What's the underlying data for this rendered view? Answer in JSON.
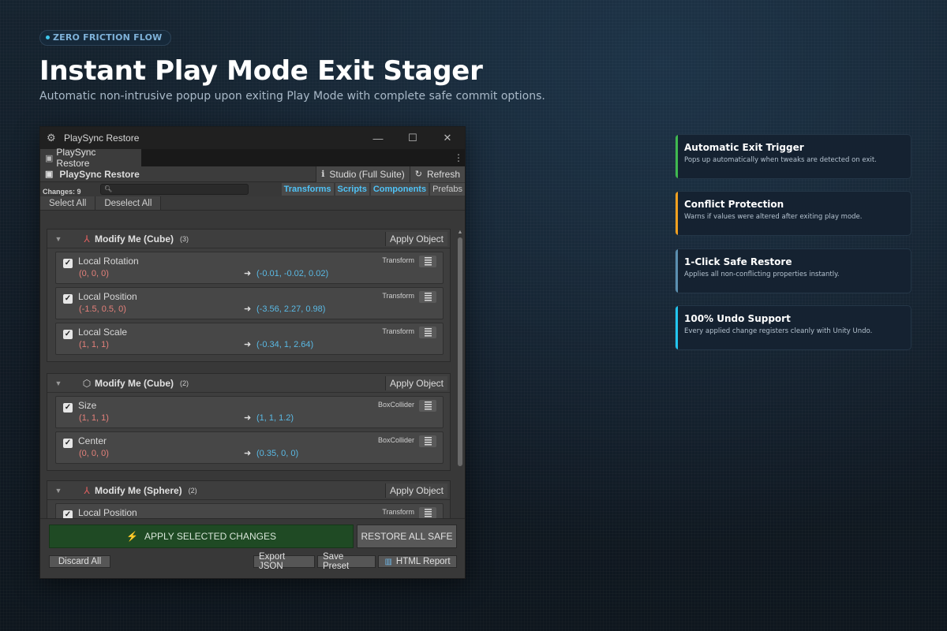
{
  "hero": {
    "badge": "ZERO FRICTION FLOW",
    "title": "Instant Play Mode Exit Stager",
    "subtitle": "Automatic non-intrusive popup upon exiting Play Mode with complete safe commit options."
  },
  "window": {
    "title": "PlaySync Restore",
    "tab_label": "PlaySync Restore",
    "toolbar": {
      "name": "PlaySync Restore",
      "edition": "Studio (Full Suite)",
      "refresh": "Refresh"
    },
    "changes_count": "Changes: 9",
    "search_placeholder": "",
    "filters": [
      "Transforms",
      "Scripts",
      "Components",
      "Prefabs"
    ],
    "select_all": "Select All",
    "deselect_all": "Deselect All",
    "apply_object_label": "Apply Object",
    "groups": [
      {
        "title": "Modify Me (Cube)",
        "count": "(3)",
        "icon": "transform-gizmo-icon",
        "props": [
          {
            "name": "Local Rotation",
            "old": "(0, 0, 0)",
            "new": "(-0.01, -0.02, 0.02)",
            "component": "Transform"
          },
          {
            "name": "Local Position",
            "old": "(-1.5, 0.5, 0)",
            "new": "(-3.56, 2.27, 0.98)",
            "component": "Transform"
          },
          {
            "name": "Local Scale",
            "old": "(1, 1, 1)",
            "new": "(-0.34, 1, 2.64)",
            "component": "Transform"
          }
        ]
      },
      {
        "title": "Modify Me (Cube)",
        "count": "(2)",
        "icon": "cube-icon",
        "props": [
          {
            "name": "Size",
            "old": "(1, 1, 1)",
            "new": "(1, 1, 1.2)",
            "component": "BoxCollider"
          },
          {
            "name": "Center",
            "old": "(0, 0, 0)",
            "new": "(0.35, 0, 0)",
            "component": "BoxCollider"
          }
        ]
      },
      {
        "title": "Modify Me (Sphere)",
        "count": "(2)",
        "icon": "transform-gizmo-icon",
        "props": [
          {
            "name": "Local Position",
            "old": "",
            "new": "",
            "component": "Transform"
          }
        ]
      }
    ],
    "footer": {
      "apply_selected": "APPLY SELECTED CHANGES",
      "restore_all": "RESTORE ALL SAFE",
      "discard_all": "Discard All",
      "export_json": "Export JSON",
      "save_preset": "Save Preset",
      "html_report": "HTML Report"
    }
  },
  "features": [
    {
      "title": "Automatic Exit Trigger",
      "desc": "Pops up automatically when tweaks are detected on exit.",
      "color": "#3fb950"
    },
    {
      "title": "Conflict Protection",
      "desc": "Warns if values were altered after exiting play mode.",
      "color": "#f0a020"
    },
    {
      "title": "1-Click Safe Restore",
      "desc": "Applies all non-conflicting properties instantly.",
      "color": "#5b8fb0"
    },
    {
      "title": "100% Undo Support",
      "desc": "Every applied change registers cleanly with Unity Undo.",
      "color": "#22c5ee"
    }
  ]
}
